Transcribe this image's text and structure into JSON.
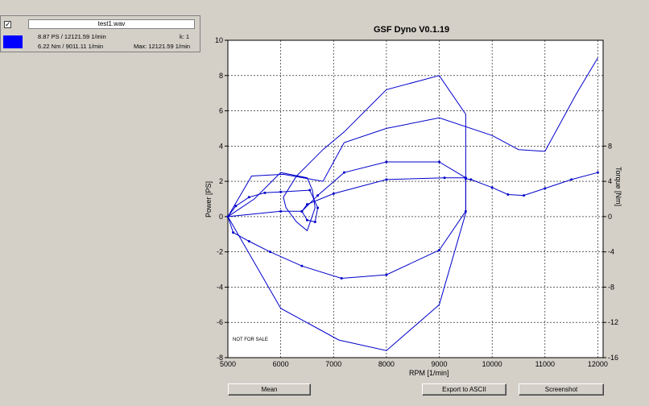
{
  "info_panel": {
    "checkbox_mark": "✓",
    "file_name": "test1.wav",
    "power_readout": "8.87 PS / 12121.59 1/min",
    "k_readout": "k: 1",
    "torque_readout": "6.22 Nm / 9011.11 1/min",
    "max_readout": "Max: 12121.59 1/min",
    "series_color": "#0000ff"
  },
  "plot": {
    "title": "GSF Dyno V0.1.19",
    "watermark": "NOT FOR SALE"
  },
  "buttons": {
    "mean": "Mean",
    "export": "Export to ASCII",
    "screenshot": "Screenshot"
  },
  "chart_data": {
    "type": "line",
    "title": "GSF Dyno V0.1.19",
    "xlabel": "RPM [1/min]",
    "ylabel": "Power [PS]",
    "y2label": "Torque [Nm]",
    "xlim": [
      5000,
      12000
    ],
    "ylim": [
      -8,
      10
    ],
    "y2lim": [
      -16,
      10
    ],
    "xticks": [
      "5000",
      "6000",
      "7000",
      "8000",
      "9000",
      "10000",
      "11000",
      "12000"
    ],
    "yticks": [
      "10",
      "8",
      "6",
      "4",
      "2",
      "0",
      "-2",
      "-4",
      "-6",
      "-8"
    ],
    "y2ticks": [
      "8",
      "4",
      "0",
      "-4",
      "-8",
      "-12",
      "-16"
    ],
    "grid": true,
    "line_color": "#0000cc",
    "series": [
      {
        "axis": "y",
        "markers": false,
        "x": [
          5000,
          5500,
          6000,
          6500,
          6600,
          6650,
          6500,
          6300,
          6100,
          6050,
          6300,
          6800,
          7200,
          8000,
          9000,
          9500,
          9500,
          9000,
          8000,
          7100,
          6000,
          5000,
          5450,
          6050,
          6800,
          7200,
          8000,
          9000,
          10000,
          10500,
          11000,
          11600,
          12000
        ],
        "y": [
          0,
          1.0,
          2.5,
          2.2,
          1.5,
          0.5,
          -0.8,
          -0.3,
          0.5,
          1.1,
          2.3,
          3.8,
          4.8,
          7.2,
          8.0,
          5.8,
          0.2,
          -5.0,
          -7.6,
          -7.0,
          -5.2,
          0,
          2.3,
          2.4,
          2.0,
          4.2,
          5.0,
          5.6,
          4.6,
          3.8,
          3.7,
          7.0,
          9.0
        ]
      },
      {
        "axis": "y",
        "markers": true,
        "x": [
          5000,
          5100,
          5400,
          5800,
          6400,
          7150,
          8000,
          9000,
          9500,
          9500,
          9100,
          8000,
          7000,
          6500,
          6400,
          6500,
          6650,
          6700,
          6550,
          6000,
          5700,
          5400,
          5150,
          5000,
          6000,
          6400,
          6700,
          7200,
          8000,
          9000,
          9500
        ],
        "y": [
          0,
          -0.9,
          -1.4,
          -2.0,
          -2.8,
          -3.5,
          -3.3,
          -1.9,
          0.3,
          2.2,
          2.2,
          2.1,
          1.3,
          0.7,
          0.3,
          -0.2,
          -0.3,
          0.5,
          1.5,
          1.4,
          1.35,
          1.1,
          0.6,
          0,
          0.3,
          0.3,
          1.2,
          2.5,
          3.1,
          3.1,
          2.2
        ]
      },
      {
        "axis": "y2",
        "markers": true,
        "x": [
          9500,
          9600,
          10000,
          10300,
          10600,
          11000,
          11500,
          12000
        ],
        "y": [
          4.3,
          4.2,
          3.3,
          2.5,
          2.4,
          3.2,
          4.2,
          5.0
        ]
      }
    ]
  }
}
